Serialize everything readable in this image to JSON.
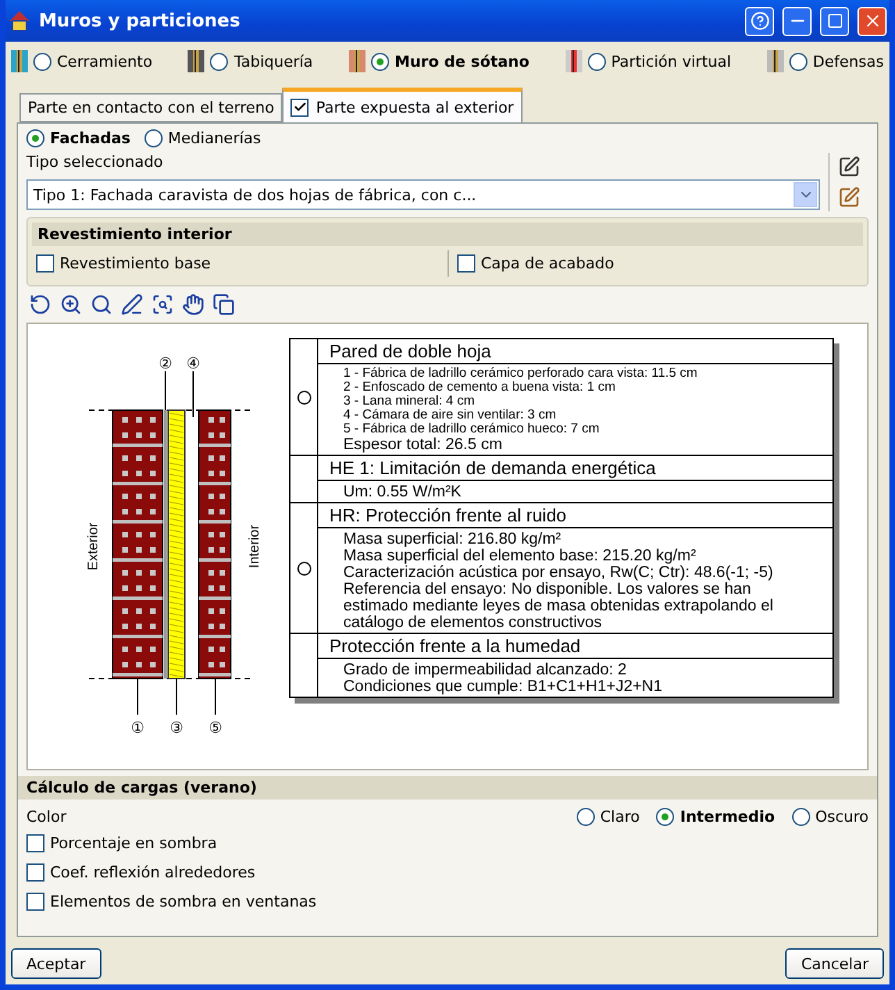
{
  "window": {
    "title": "Muros y particiones"
  },
  "element_types": [
    {
      "label": "Cerramiento",
      "selected": false
    },
    {
      "label": "Tabiquería",
      "selected": false
    },
    {
      "label": "Muro de sótano",
      "selected": true
    },
    {
      "label": "Partición virtual",
      "selected": false
    },
    {
      "label": "Defensas",
      "selected": false
    }
  ],
  "tabs": [
    {
      "label": "Parte en contacto con el terreno",
      "selected": false,
      "checked": false
    },
    {
      "label": "Parte expuesta al exterior",
      "selected": true,
      "checked": true
    }
  ],
  "facade_type": [
    {
      "label": "Fachadas",
      "selected": true
    },
    {
      "label": "Medianerías",
      "selected": false
    }
  ],
  "type_field": {
    "label": "Tipo seleccionado",
    "value": "Tipo 1: Fachada caravista de dos hojas de fábrica, con c..."
  },
  "interior_finish": {
    "title": "Revestimiento interior",
    "options": [
      {
        "label": "Revestimiento base",
        "checked": false
      },
      {
        "label": "Capa de acabado",
        "checked": false
      }
    ]
  },
  "drawing": {
    "side_labels": [
      "Exterior",
      "Interior"
    ],
    "top_markers": [
      "②",
      "④"
    ],
    "bottom_markers": [
      "①",
      "③",
      "⑤"
    ]
  },
  "report": {
    "sections": [
      {
        "title": "Pared de doble hoja",
        "compact": true,
        "marked": true,
        "lines": [
          "1 - Fábrica de ladrillo cerámico perforado cara vista: 11.5 cm",
          "2 - Enfoscado de cemento a buena vista: 1 cm",
          "3 - Lana mineral: 4 cm",
          "4 - Cámara de aire sin ventilar: 3 cm",
          "5 - Fábrica de ladrillo cerámico hueco: 7 cm"
        ],
        "footer": "Espesor total: 26.5 cm"
      },
      {
        "title": "HE 1: Limitación de demanda energética",
        "compact": false,
        "marked": false,
        "lines": [
          "Um: 0.55 W/m²K"
        ]
      },
      {
        "title": "HR: Protección frente al ruido",
        "compact": false,
        "marked": true,
        "lines": [
          "Masa superficial: 216.80 kg/m²",
          "Masa superficial del elemento base: 215.20 kg/m²",
          "Caracterización acústica por ensayo, Rw(C; Ctr): 48.6(-1; -5)",
          "Referencia del ensayo: No disponible. Los valores se han estimado mediante leyes de masa obtenidas extrapolando el catálogo de elementos constructivos"
        ]
      },
      {
        "title": "Protección frente a la humedad",
        "compact": false,
        "marked": false,
        "lines": [
          "Grado de impermeabilidad alcanzado: 2",
          "Condiciones que cumple: B1+C1+H1+J2+N1"
        ]
      }
    ]
  },
  "loads": {
    "title": "Cálculo de cargas (verano)",
    "color_label": "Color",
    "colors": [
      {
        "label": "Claro",
        "selected": false
      },
      {
        "label": "Intermedio",
        "selected": true
      },
      {
        "label": "Oscuro",
        "selected": false
      }
    ],
    "options": [
      {
        "label": "Porcentaje en sombra",
        "checked": false
      },
      {
        "label": "Coef. reflexión alrededores",
        "checked": false
      },
      {
        "label": "Elementos de sombra en ventanas",
        "checked": false
      }
    ]
  },
  "buttons": [
    "Aceptar",
    "Cancelar"
  ]
}
